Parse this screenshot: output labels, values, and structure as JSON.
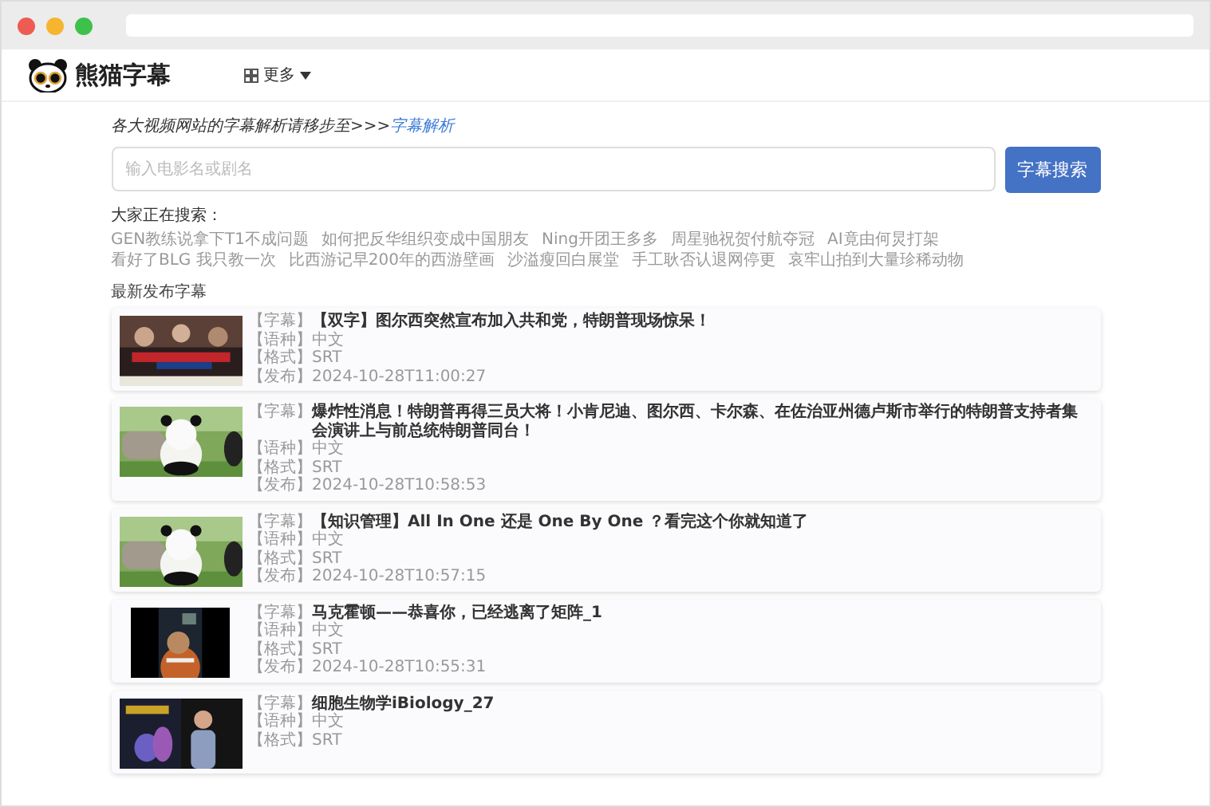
{
  "nav": {
    "logo_text": "熊猫字幕",
    "menu": {
      "label": "更多"
    }
  },
  "notice": {
    "text": "各大视频网站的字幕解析请移步至>>>",
    "link": "字幕解析"
  },
  "search": {
    "placeholder": "输入电影名或剧名",
    "button": "字幕搜索"
  },
  "hot": {
    "title": "大家正在搜索：",
    "items": [
      "GEN教练说拿下T1不成问题",
      "如何把反华组织变成中国朋友",
      "Ning开团王多多",
      "周星驰祝贺付航夺冠",
      "AI竟由何炅打架",
      "看好了BLG 我只教一次",
      "比西游记早200年的西游壁画",
      "沙溢瘦回白展堂",
      "手工耿否认退网停更",
      "哀牢山拍到大量珍稀动物"
    ]
  },
  "latest": {
    "title": "最新发布字幕",
    "items": [
      {
        "kind": "picture",
        "subtitle_label": "【字幕】",
        "title": "【双字】图尔西突然宣布加入共和党，特朗普现场惊呆！",
        "lang_label": "【语种】",
        "lang": "中文",
        "format_label": "【格式】",
        "format": "SRT",
        "date_label": "【发布】",
        "date": "2024-10-28T11:00:27"
      },
      {
        "kind": "picture",
        "subtitle_label": "【字幕】",
        "title": "爆炸性消息！特朗普再得三员大将！小肯尼迪、图尔西、卡尔森、在佐治亚州德卢斯市举行的特朗普支持者集会演讲上与前总统特朗普同台！",
        "lang_label": "【语种】",
        "lang": "中文",
        "format_label": "【格式】",
        "format": "SRT",
        "date_label": "【发布】",
        "date": "2024-10-28T10:58:53"
      },
      {
        "kind": "picture",
        "subtitle_label": "【字幕】",
        "title": "【知识管理】All In One 还是 One By One ？看完这个你就知道了",
        "lang_label": "【语种】",
        "lang": "中文",
        "format_label": "【格式】",
        "format": "SRT",
        "date_label": "【发布】",
        "date": "2024-10-28T10:57:15"
      },
      {
        "kind": "picture",
        "subtitle_label": "【字幕】",
        "title": "马克霍顿——恭喜你，已经逃离了矩阵_1",
        "lang_label": "【语种】",
        "lang": "中文",
        "format_label": "【格式】",
        "format": "SRT",
        "date_label": "【发布】",
        "date": "2024-10-28T10:55:31"
      },
      {
        "kind": "picture",
        "subtitle_label": "【字幕】",
        "title": "细胞生物学iBiology_27",
        "lang_label": "【语种】",
        "lang": "中文",
        "format_label": "【格式】",
        "format": "SRT"
      }
    ]
  }
}
